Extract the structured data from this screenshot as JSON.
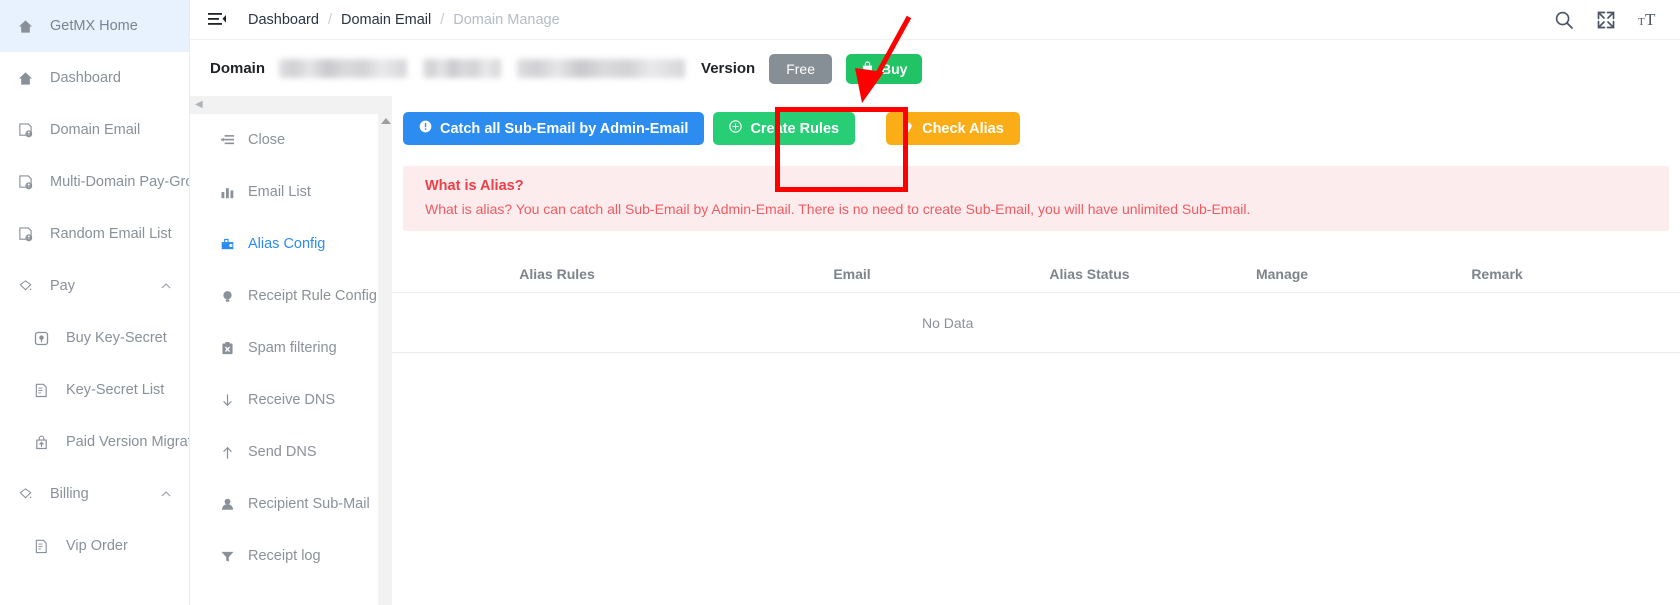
{
  "sidebar": {
    "items": [
      {
        "label": "GetMX Home",
        "icon": "home-icon",
        "active": true,
        "level": 0,
        "expandable": false
      },
      {
        "label": "Dashboard",
        "icon": "home-icon",
        "active": false,
        "level": 0,
        "expandable": false
      },
      {
        "label": "Domain Email",
        "icon": "globe-doc-icon",
        "active": false,
        "level": 0,
        "expandable": false
      },
      {
        "label": "Multi-Domain Pay-Group",
        "icon": "globe-doc-icon",
        "active": false,
        "level": 0,
        "expandable": false
      },
      {
        "label": "Random Email List",
        "icon": "globe-doc-icon",
        "active": false,
        "level": 0,
        "expandable": false
      },
      {
        "label": "Pay",
        "icon": "diamond-icon",
        "active": false,
        "level": 0,
        "expandable": true,
        "caret": "chevron-up-icon"
      },
      {
        "label": "Buy Key-Secret",
        "icon": "key-box-icon",
        "active": false,
        "level": 1,
        "expandable": false
      },
      {
        "label": "Key-Secret List",
        "icon": "doc-list-icon",
        "active": false,
        "level": 1,
        "expandable": false
      },
      {
        "label": "Paid Version Migration",
        "icon": "upload-bag-icon",
        "active": false,
        "level": 1,
        "expandable": false
      },
      {
        "label": "Billing",
        "icon": "diamond-icon",
        "active": false,
        "level": 0,
        "expandable": true,
        "caret": "chevron-up-icon"
      },
      {
        "label": "Vip Order",
        "icon": "doc-list-icon",
        "active": false,
        "level": 1,
        "expandable": false
      }
    ]
  },
  "header": {
    "menu_toggle_icon": "hamburger-collapse-icon",
    "breadcrumb": [
      {
        "label": "Dashboard",
        "muted": false
      },
      {
        "label": "Domain Email",
        "muted": false
      },
      {
        "label": "Domain Manage",
        "muted": true
      }
    ],
    "separator": "/",
    "actions": [
      {
        "name": "search-icon",
        "label": "Search"
      },
      {
        "name": "fullscreen-icon",
        "label": "Fullscreen"
      },
      {
        "name": "font-size-icon",
        "label": "Font Size"
      }
    ]
  },
  "domain_bar": {
    "domain_label": "Domain",
    "domain_value_redacted": true,
    "version_label": "Version",
    "free_badge": "Free",
    "buy_button": "Buy",
    "buy_icon": "lock-bag-icon"
  },
  "submenu": {
    "collapse_icon": "chevron-left-icon",
    "items": [
      {
        "label": "Close",
        "icon": "list-collapse-icon",
        "active": false
      },
      {
        "label": "Email List",
        "icon": "bar-chart-icon",
        "active": false
      },
      {
        "label": "Alias Config",
        "icon": "wallet-icon",
        "active": true
      },
      {
        "label": "Receipt Rule Config",
        "icon": "bulb-icon",
        "active": false
      },
      {
        "label": "Spam filtering",
        "icon": "clipboard-x-icon",
        "active": false
      },
      {
        "label": "Receive DNS",
        "icon": "arrow-down-icon",
        "active": false
      },
      {
        "label": "Send DNS",
        "icon": "arrow-up-icon",
        "active": false
      },
      {
        "label": "Recipient Sub-Mail",
        "icon": "user-icon",
        "active": false
      },
      {
        "label": "Receipt log",
        "icon": "funnel-icon",
        "active": false
      }
    ]
  },
  "toolbar": {
    "catch_all_button": "Catch all Sub-Email by Admin-Email",
    "catch_all_icon": "info-circle-icon",
    "create_rules_button": "Create Rules",
    "create_rules_icon": "plus-circle-icon",
    "check_alias_button": "Check Alias",
    "check_alias_icon": "bulb-icon"
  },
  "alert": {
    "title": "What is Alias?",
    "body": "What is alias? You can catch all Sub-Email by Admin-Email. There is no need to create Sub-Email, you will have unlimited Sub-Email."
  },
  "table": {
    "columns": [
      "Alias Rules",
      "Email",
      "Alias Status",
      "Manage",
      "Remark"
    ],
    "rows": [],
    "empty_text": "No Data"
  },
  "annotations": {
    "highlight_box_target": "check-alias-button",
    "arrow_color": "#ff0000",
    "box_color": "#ff0000"
  },
  "colors": {
    "primary_blue": "#2d8cf0",
    "green": "#27ce76",
    "orange": "#fbad17",
    "buy_green": "#21c464",
    "free_gray": "#868e96",
    "alert_bg": "#fdecee",
    "alert_text": "#ec4049",
    "annotation_red": "#ff0000"
  }
}
